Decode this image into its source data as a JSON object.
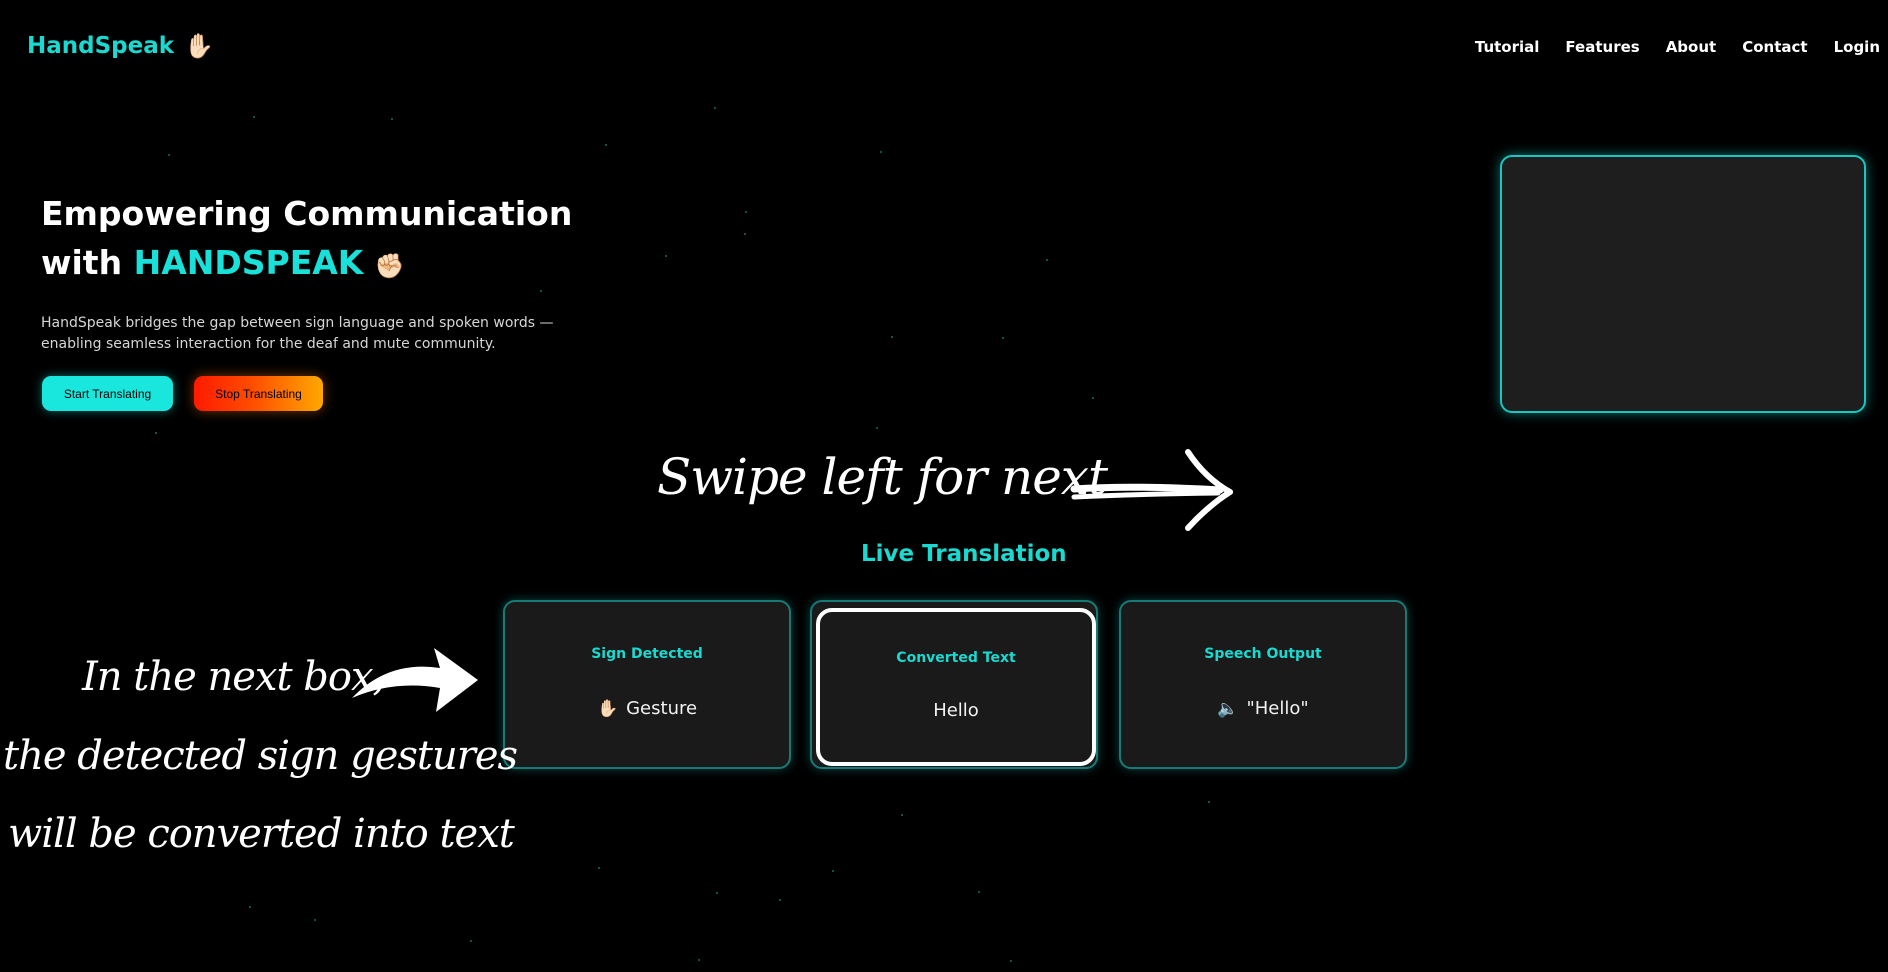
{
  "nav": {
    "logo_text": "HandSpeak",
    "logo_icon": "raised-hand-icon",
    "items": [
      {
        "label": "Tutorial"
      },
      {
        "label": "Features"
      },
      {
        "label": "About"
      },
      {
        "label": "Contact"
      },
      {
        "label": "Login"
      }
    ]
  },
  "hero": {
    "title_line1": "Empowering Communication",
    "title_line2_prefix": "with",
    "title_brand": "HANDSPEAK",
    "title_icon": "raised-fist-icon",
    "description_line1": "HandSpeak bridges the gap between sign language and spoken words —",
    "description_line2": "enabling seamless interaction for the deaf and mute community.",
    "start_button": "Start Translating",
    "stop_button": "Stop Translating"
  },
  "annotations": {
    "swipe_text": "Swipe left for next",
    "box_note_line1": "In the next box,",
    "box_note_line2": "the detected sign gestures",
    "box_note_line3": "will be converted into text"
  },
  "live_translation": {
    "title": "Live Translation",
    "cards": [
      {
        "label": "Sign Detected",
        "value": "Gesture",
        "icon": "raised-hand-icon"
      },
      {
        "label": "Converted Text",
        "value": "Hello"
      },
      {
        "label": "Speech Output",
        "value": "\"Hello\"",
        "icon": "speaker-icon"
      }
    ]
  },
  "colors": {
    "accent": "#19d9d0",
    "background": "#000000",
    "card": "#1a1a1a",
    "stop_gradient_start": "#ff1a00",
    "stop_gradient_end": "#ffa800"
  }
}
